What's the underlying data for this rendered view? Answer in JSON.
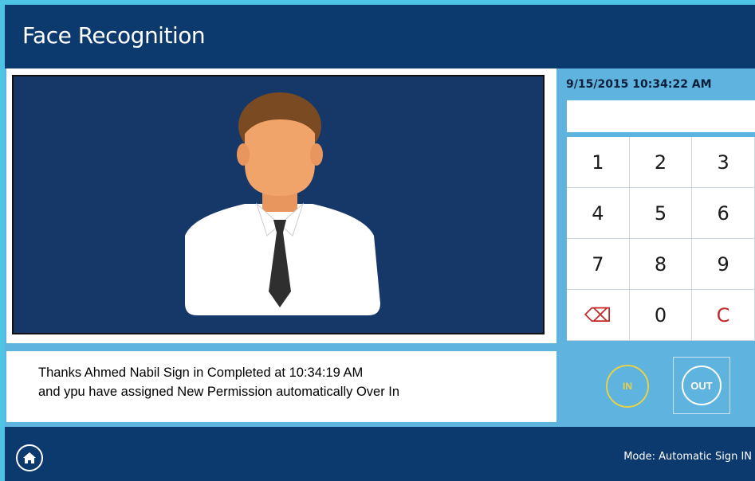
{
  "header": {
    "title": "Face Recognition"
  },
  "camera": {
    "avatar_icon": "user-avatar-icon"
  },
  "message": {
    "line1": "Thanks Ahmed Nabil Sign in Completed at 10:34:19 AM",
    "line2": "and ypu have assigned New Permission automatically Over In"
  },
  "panel": {
    "datetime": "9/15/2015 10:34:22 AM",
    "pin_value": ""
  },
  "keypad": {
    "k1": "1",
    "k2": "2",
    "k3": "3",
    "k4": "4",
    "k5": "5",
    "k6": "6",
    "k7": "7",
    "k8": "8",
    "k9": "9",
    "backspace": "⌫",
    "k0": "0",
    "clear": "C"
  },
  "actions": {
    "in_label": "IN",
    "out_label": "OUT"
  },
  "footer": {
    "mode": "Mode: Automatic Sign IN"
  },
  "colors": {
    "accent_red": "#c62828",
    "in_yellow": "#e6d24a",
    "navy": "#0d3a6e"
  }
}
